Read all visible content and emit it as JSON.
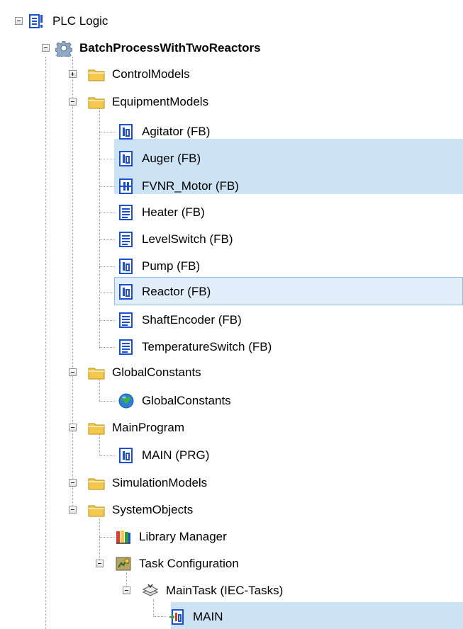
{
  "tree": {
    "root": {
      "label": "PLC Logic",
      "icon": "plc-logic-icon"
    },
    "project": {
      "label": "BatchProcessWithTwoReactors",
      "icon": "gear-icon"
    },
    "nodes": [
      {
        "label": "ControlModels",
        "icon": "folder-icon",
        "expanded": false
      },
      {
        "label": "EquipmentModels",
        "icon": "folder-icon",
        "expanded": true
      },
      {
        "label": "Agitator (FB)",
        "icon": "function-block-icon"
      },
      {
        "label": "Auger (FB)",
        "icon": "function-block-icon",
        "selected": true
      },
      {
        "label": "FVNR_Motor (FB)",
        "icon": "sfc-function-block-icon",
        "selected": true
      },
      {
        "label": "Heater (FB)",
        "icon": "text-pou-icon"
      },
      {
        "label": "LevelSwitch (FB)",
        "icon": "text-pou-icon"
      },
      {
        "label": "Pump (FB)",
        "icon": "function-block-icon"
      },
      {
        "label": "Reactor (FB)",
        "icon": "function-block-icon",
        "selected": true,
        "focused": true
      },
      {
        "label": "ShaftEncoder (FB)",
        "icon": "text-pou-icon"
      },
      {
        "label": "TemperatureSwitch (FB)",
        "icon": "text-pou-icon"
      },
      {
        "label": "GlobalConstants",
        "icon": "folder-icon",
        "expanded": true
      },
      {
        "label": "GlobalConstants",
        "icon": "global-variable-list-icon"
      },
      {
        "label": "MainProgram",
        "icon": "folder-icon",
        "expanded": true
      },
      {
        "label": "MAIN (PRG)",
        "icon": "program-icon"
      },
      {
        "label": "SimulationModels",
        "icon": "folder-icon",
        "expanded": true
      },
      {
        "label": "SystemObjects",
        "icon": "folder-icon",
        "expanded": true
      },
      {
        "label": "Library Manager",
        "icon": "library-manager-icon"
      },
      {
        "label": "Task Configuration",
        "icon": "task-configuration-icon",
        "expanded": true
      },
      {
        "label": "MainTask (IEC-Tasks)",
        "icon": "task-icon",
        "expanded": true
      },
      {
        "label": "MAIN",
        "icon": "program-call-icon",
        "selected": true
      }
    ]
  },
  "colors": {
    "selection": "#cce3f5",
    "focus_border": "#8dc0e8",
    "folder": "#f2c94c",
    "pou_blue": "#1a4fcf"
  }
}
